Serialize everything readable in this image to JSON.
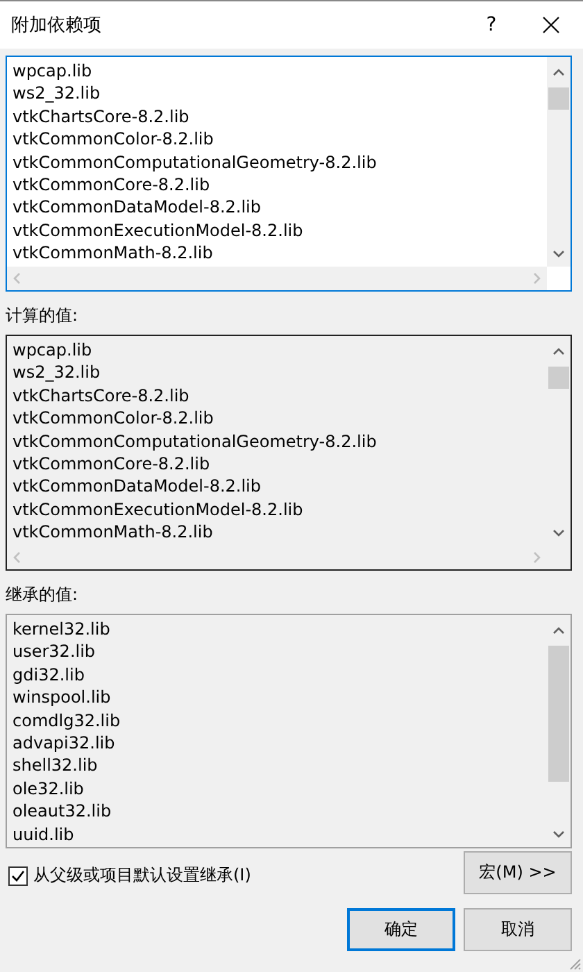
{
  "window": {
    "title": "附加依赖项",
    "help": "?"
  },
  "edit_box": {
    "lines": [
      "wpcap.lib",
      "ws2_32.lib",
      "vtkChartsCore-8.2.lib",
      "vtkCommonColor-8.2.lib",
      "vtkCommonComputationalGeometry-8.2.lib",
      "vtkCommonCore-8.2.lib",
      "vtkCommonDataModel-8.2.lib",
      "vtkCommonExecutionModel-8.2.lib",
      "vtkCommonMath-8.2.lib"
    ]
  },
  "computed": {
    "label": "计算的值:",
    "lines": [
      "wpcap.lib",
      "ws2_32.lib",
      "vtkChartsCore-8.2.lib",
      "vtkCommonColor-8.2.lib",
      "vtkCommonComputationalGeometry-8.2.lib",
      "vtkCommonCore-8.2.lib",
      "vtkCommonDataModel-8.2.lib",
      "vtkCommonExecutionModel-8.2.lib",
      "vtkCommonMath-8.2.lib"
    ]
  },
  "inherited": {
    "label": "继承的值:",
    "lines": [
      "kernel32.lib",
      "user32.lib",
      "gdi32.lib",
      "winspool.lib",
      "comdlg32.lib",
      "advapi32.lib",
      "shell32.lib",
      "ole32.lib",
      "oleaut32.lib",
      "uuid.lib"
    ]
  },
  "inherit_checkbox": {
    "label": "从父级或项目默认设置继承(I)",
    "checked": true
  },
  "macro_button": "宏(M) >>",
  "buttons": [
    {
      "label": "确定",
      "default": true
    },
    {
      "label": "取消",
      "default": false
    }
  ]
}
